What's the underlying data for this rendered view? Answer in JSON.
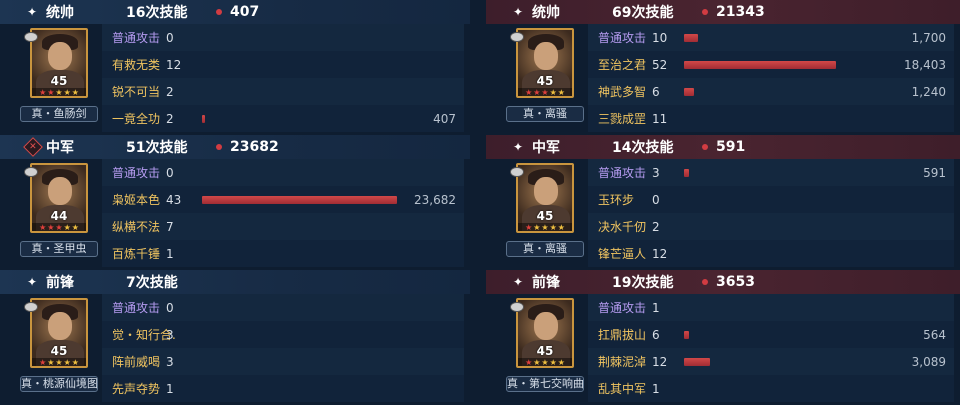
{
  "left": [
    {
      "role": "统帅",
      "role_icon": "sparkle-icon",
      "times": "16次技能",
      "total": "407",
      "level": "45",
      "weapon": "真・鱼肠剑",
      "stars": [
        "red",
        "red",
        "gold",
        "gold",
        "gold"
      ],
      "skills": [
        {
          "name": "普通攻击",
          "count": "0",
          "basic": true,
          "damage": "",
          "fraction": 0
        },
        {
          "name": "有救无类",
          "count": "12",
          "basic": false,
          "damage": "",
          "fraction": 0
        },
        {
          "name": "锐不可当",
          "count": "2",
          "basic": false,
          "damage": "",
          "fraction": 0
        },
        {
          "name": "一竟全功",
          "count": "2",
          "basic": false,
          "damage": "407",
          "fraction": 0.017
        }
      ]
    },
    {
      "role": "中军",
      "role_icon": "diamond-icon",
      "times": "51次技能",
      "total": "23682",
      "level": "44",
      "weapon": "真・圣甲虫",
      "stars": [
        "red",
        "red",
        "red",
        "gold",
        "gold"
      ],
      "skills": [
        {
          "name": "普通攻击",
          "count": "0",
          "basic": true,
          "damage": "",
          "fraction": 0
        },
        {
          "name": "枭姬本色",
          "count": "43",
          "basic": false,
          "damage": "23,682",
          "fraction": 1.0
        },
        {
          "name": "纵横不法",
          "count": "7",
          "basic": false,
          "damage": "",
          "fraction": 0
        },
        {
          "name": "百炼千锤",
          "count": "1",
          "basic": false,
          "damage": "",
          "fraction": 0
        }
      ]
    },
    {
      "role": "前锋",
      "role_icon": "sparkle-icon",
      "times": "7次技能",
      "total": "",
      "level": "45",
      "weapon": "真・桃源仙境图",
      "stars": [
        "red",
        "gold",
        "gold",
        "gold",
        "gold"
      ],
      "skills": [
        {
          "name": "普通攻击",
          "count": "0",
          "basic": true,
          "damage": "",
          "fraction": 0
        },
        {
          "name": "觉・知行合.",
          "count": "3",
          "basic": false,
          "damage": "",
          "fraction": 0
        },
        {
          "name": "阵前威喝",
          "count": "3",
          "basic": false,
          "damage": "",
          "fraction": 0
        },
        {
          "name": "先声夺势",
          "count": "1",
          "basic": false,
          "damage": "",
          "fraction": 0
        }
      ]
    }
  ],
  "right": [
    {
      "role": "统帅",
      "role_icon": "sparkle-icon",
      "times": "69次技能",
      "total": "21343",
      "level": "45",
      "weapon": "真・离骚",
      "stars": [
        "red",
        "red",
        "red",
        "gold",
        "gold"
      ],
      "skills": [
        {
          "name": "普通攻击",
          "count": "10",
          "basic": true,
          "damage": "1,700",
          "fraction": 0.092
        },
        {
          "name": "至治之君",
          "count": "52",
          "basic": false,
          "damage": "18,403",
          "fraction": 1.0
        },
        {
          "name": "神武多智",
          "count": "6",
          "basic": false,
          "damage": "1,240",
          "fraction": 0.067
        },
        {
          "name": "三戮成罡",
          "count": "11",
          "basic": false,
          "damage": "",
          "fraction": 0
        }
      ]
    },
    {
      "role": "中军",
      "role_icon": "sparkle-icon",
      "times": "14次技能",
      "total": "591",
      "level": "45",
      "weapon": "真・离骚",
      "stars": [
        "red",
        "gold",
        "gold",
        "gold",
        "gold"
      ],
      "skills": [
        {
          "name": "普通攻击",
          "count": "3",
          "basic": true,
          "damage": "591",
          "fraction": 0.032
        },
        {
          "name": "玉环步",
          "count": "0",
          "basic": false,
          "damage": "",
          "fraction": 0
        },
        {
          "name": "决水千仞",
          "count": "2",
          "basic": false,
          "damage": "",
          "fraction": 0
        },
        {
          "name": "锋芒逼人",
          "count": "12",
          "basic": false,
          "damage": "",
          "fraction": 0
        }
      ]
    },
    {
      "role": "前锋",
      "role_icon": "sparkle-icon",
      "times": "19次技能",
      "total": "3653",
      "level": "45",
      "weapon": "真・第七交响曲",
      "stars": [
        "red",
        "gold",
        "gold",
        "gold",
        "gold"
      ],
      "skills": [
        {
          "name": "普通攻击",
          "count": "1",
          "basic": true,
          "damage": "",
          "fraction": 0
        },
        {
          "name": "扛鼎拔山",
          "count": "6",
          "basic": false,
          "damage": "564",
          "fraction": 0.031
        },
        {
          "name": "荆棘泥淖",
          "count": "12",
          "basic": false,
          "damage": "3,089",
          "fraction": 0.168
        },
        {
          "name": "乱其中军",
          "count": "1",
          "basic": false,
          "damage": "",
          "fraction": 0
        }
      ]
    }
  ]
}
